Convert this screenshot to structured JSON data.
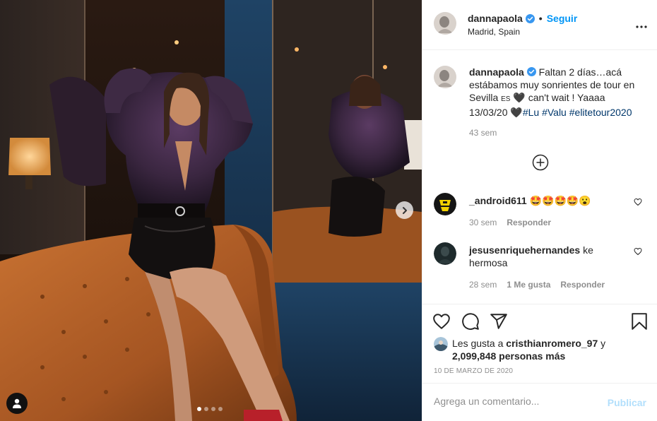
{
  "post": {
    "username": "dannapaola",
    "follow_label": "Seguir",
    "location": "Madrid, Spain",
    "more_label": "•••",
    "carousel_dots": 4,
    "active_dot": 0
  },
  "caption": {
    "username": "dannapaola",
    "text_1": "Faltan 2 días…acá estábamos muy sonrientes de tour en Sevilla",
    "text_flag": "ES",
    "text_2": "can't wait ! Yaaaa 13/03/20",
    "hashtags": [
      "#Lu",
      "#Valu",
      "#elitetour2020"
    ],
    "time": "43 sem"
  },
  "comments": [
    {
      "username": "_android611",
      "text": "🤩🤩🤩🤩😮",
      "time": "30 sem",
      "reply_label": "Responder"
    },
    {
      "username": "jesusenriquehernandes",
      "text": "ke hermosa",
      "time": "28 sem",
      "likes_label": "1 Me gusta",
      "reply_label": "Responder"
    }
  ],
  "likes": {
    "prefix": "Les gusta a",
    "user": "cristhianromero_97",
    "conj": "y",
    "others": "2,099,848 personas más"
  },
  "date": "10 DE MARZO DE 2020",
  "comment_box": {
    "placeholder": "Agrega un comentario...",
    "post_label": "Publicar"
  },
  "colors": {
    "accent": "#0095f6",
    "hashtag": "#00376b",
    "muted": "#8e8e8e",
    "post_disabled": "#b2dffc",
    "sofa": "#b5652a",
    "wall_blue": "#1d3a58"
  },
  "icons": [
    "verified-icon",
    "more-icon",
    "add-comment-icon",
    "heart-icon",
    "comment-icon",
    "share-icon",
    "bookmark-icon",
    "user-tag-icon",
    "chevron-right-icon"
  ]
}
